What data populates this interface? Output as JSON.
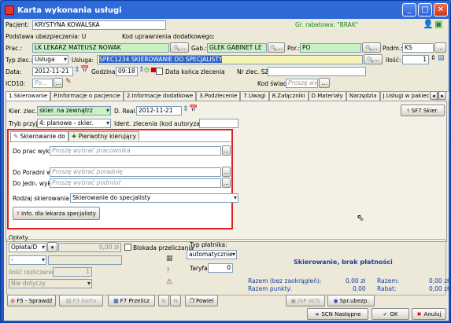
{
  "window": {
    "title": "Karta wykonania usługi"
  },
  "row1": {
    "pacjent_label": "Pacjent:",
    "pacjent": "KRYSTYNA KOWALSKA",
    "gr_rabatowa": "Gr. rabatowa: \"BRAK\""
  },
  "row2": {
    "podstawa": "Podstawa ubezpieczenia: U",
    "kod": "Kod uprawnienia dodatkowego:"
  },
  "row3": {
    "prac_label": "Prac.:",
    "prac": "LK LEKARZ MATEUSZ NOWAK",
    "gab_label": "Gab.:",
    "gab": "GLEK GABINET LE",
    "por_label": "Por.:",
    "por": "PO",
    "podm_label": "Podm.:",
    "podm": "KS"
  },
  "row4": {
    "typ_label": "Typ zlec.:",
    "typ": "Usługa",
    "usluga_label": "Usługa:",
    "usluga": "SPEC1234 SKIEROWANIE DO SPECJALISTY",
    "ilosc_label": "Ilość:",
    "ilosc": "1"
  },
  "row5": {
    "data_label": "Data:",
    "data": "2012-11-21",
    "godzina_label": "Godzina:",
    "godzina": "09:18",
    "data_konca": "Data końca zlecenia",
    "nr_sz": "Nr zlec. SZ:"
  },
  "row6": {
    "icd_label": "ICD10:",
    "icd_ph": "Po...",
    "kod_swiad": "Kod świad.:",
    "kod_swiad_ph": "Proszę wyb"
  },
  "tabs": [
    "1.Skierowanie",
    "P.Informacje o pacjencie",
    "2.Informacje dodatkowe",
    "3.Podzlecenie",
    "7.Uwagi",
    "8.Załączniki",
    "D.Materiały",
    "Narzędzia",
    "J.Usługi w pakiecie",
    "N."
  ],
  "kier": {
    "kier_label": "Kier. zlec.:",
    "kier": "skier. na zewnątrz",
    "d_real_label": "D. Real.:",
    "d_real": "2012-11-21",
    "sf7": "SF7 Skier.",
    "tryb_label": "Tryb przyj.:",
    "tryb": "4: planowe - skier.",
    "ident_label": "Ident. zlecenia (kod autoryzacji):"
  },
  "subtabs": [
    "Skierowanie do",
    "Pierwotny kierujący"
  ],
  "skier": {
    "do_prac_label": "Do prac wyk.:",
    "do_prac_ph": "Proszę wybrać pracownika",
    "do_poradni_label": "Do Poradni wyk.:",
    "do_poradni_ph": "Proszę wybrać poradnię",
    "do_jedn_label": "Do Jedn. wyk.:",
    "do_jedn_ph": "Proszę wybrać podmiot",
    "rodzaj_label": "Rodzaj skierowania:",
    "rodzaj": "Skierowanie do specjalisty",
    "info_btn": "Info. dla lekarza specjalisty"
  },
  "oplaty": {
    "title": "Opłaty",
    "oplata": "Opłata/D",
    "kwota": "0,00 zł",
    "blokada": "Blokada przeliczania",
    "dash": "-",
    "ilosc_rozl_label": "Ilość rozliczeniowa:",
    "ilosc_rozl": "1",
    "nie_dotyczy": "Nie dotyczy",
    "typ_platnika_label": "Typ płatnika:",
    "typ_platnika": "automatycznie",
    "taryfa_label": "Taryfa:",
    "taryfa": "0",
    "status": "Skierowanie, brak płatności",
    "razem_bez_label": "Razem (bez zaokrągleń):",
    "razem_bez": "0,00 zł",
    "razem_label": "Razem:",
    "razem": "0,00 zł",
    "razem_pkt_label": "Razem punkty:",
    "razem_pkt": "0,00",
    "rabat_label": "Rabat:",
    "rabat": "0,00 zł"
  },
  "buttons": {
    "f5": "F5 - Sprawdź",
    "f3": "F3 Karta",
    "f7": "F7 Przelicz",
    "powiel": "Powiel",
    "jgp": "JGP ADS",
    "spr": "Spr.ubezp.",
    "scn": "SCN Następne",
    "ok": "OK",
    "anuluj": "Anuluj"
  },
  "colors": {
    "red_box": "#e02020",
    "titlebar": "#2f6bd8"
  }
}
